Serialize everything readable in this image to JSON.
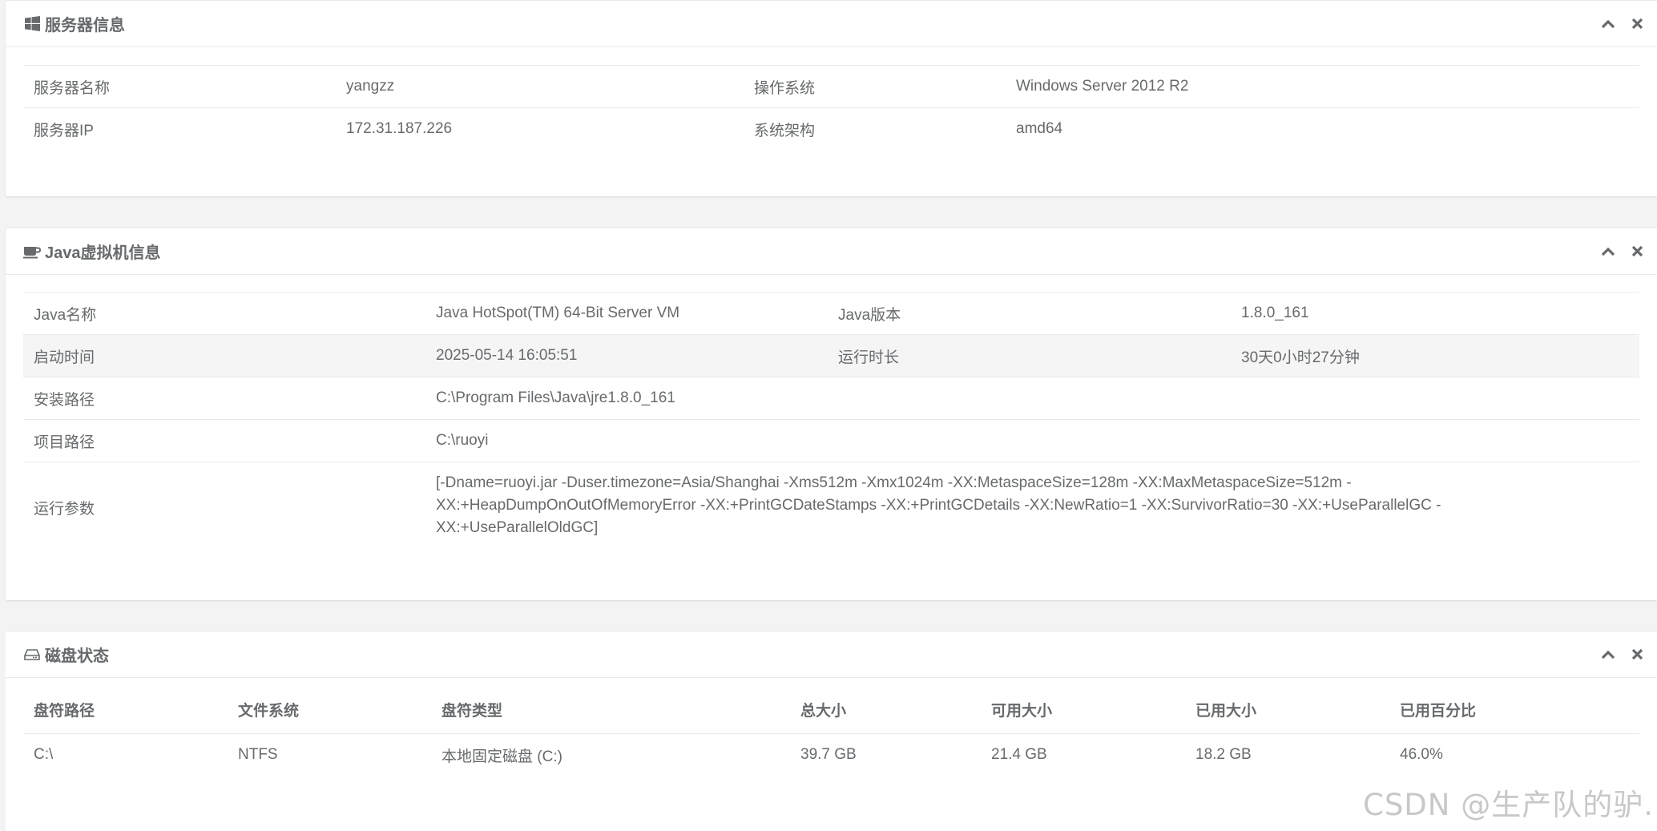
{
  "server_panel": {
    "title": "服务器信息",
    "rows": [
      [
        "服务器名称",
        "yangzz",
        "操作系统",
        "Windows Server 2012 R2"
      ],
      [
        "服务器IP",
        "172.31.187.226",
        "系统架构",
        "amd64"
      ]
    ]
  },
  "jvm_panel": {
    "title": "Java虚拟机信息",
    "rows": [
      [
        "Java名称",
        "Java HotSpot(TM) 64-Bit Server VM",
        "Java版本",
        "1.8.0_161"
      ],
      [
        "启动时间",
        "2025-05-14 16:05:51",
        "运行时长",
        "30天0小时27分钟"
      ]
    ],
    "install_path_label": "安装路径",
    "install_path": "C:\\Program Files\\Java\\jre1.8.0_161",
    "project_path_label": "项目路径",
    "project_path": "C:\\ruoyi",
    "args_label": "运行参数",
    "args": "[-Dname=ruoyi.jar -Duser.timezone=Asia/Shanghai -Xms512m -Xmx1024m -XX:MetaspaceSize=128m -XX:MaxMetaspaceSize=512m -XX:+HeapDumpOnOutOfMemoryError -XX:+PrintGCDateStamps -XX:+PrintGCDetails -XX:NewRatio=1 -XX:SurvivorRatio=30 -XX:+UseParallelGC -XX:+UseParallelOldGC]"
  },
  "disk_panel": {
    "title": "磁盘状态",
    "headers": [
      "盘符路径",
      "文件系统",
      "盘符类型",
      "总大小",
      "可用大小",
      "已用大小",
      "已用百分比"
    ],
    "rows": [
      [
        "C:\\",
        "NTFS",
        "本地固定磁盘 (C:)",
        "39.7 GB",
        "21.4 GB",
        "18.2 GB",
        "46.0%"
      ]
    ]
  },
  "watermark": "CSDN @生产队的驴.",
  "icons": {
    "server": "windows-icon",
    "jvm": "coffee-icon",
    "disk": "hdd-icon",
    "collapse": "chevron-up-icon",
    "close": "close-icon"
  }
}
